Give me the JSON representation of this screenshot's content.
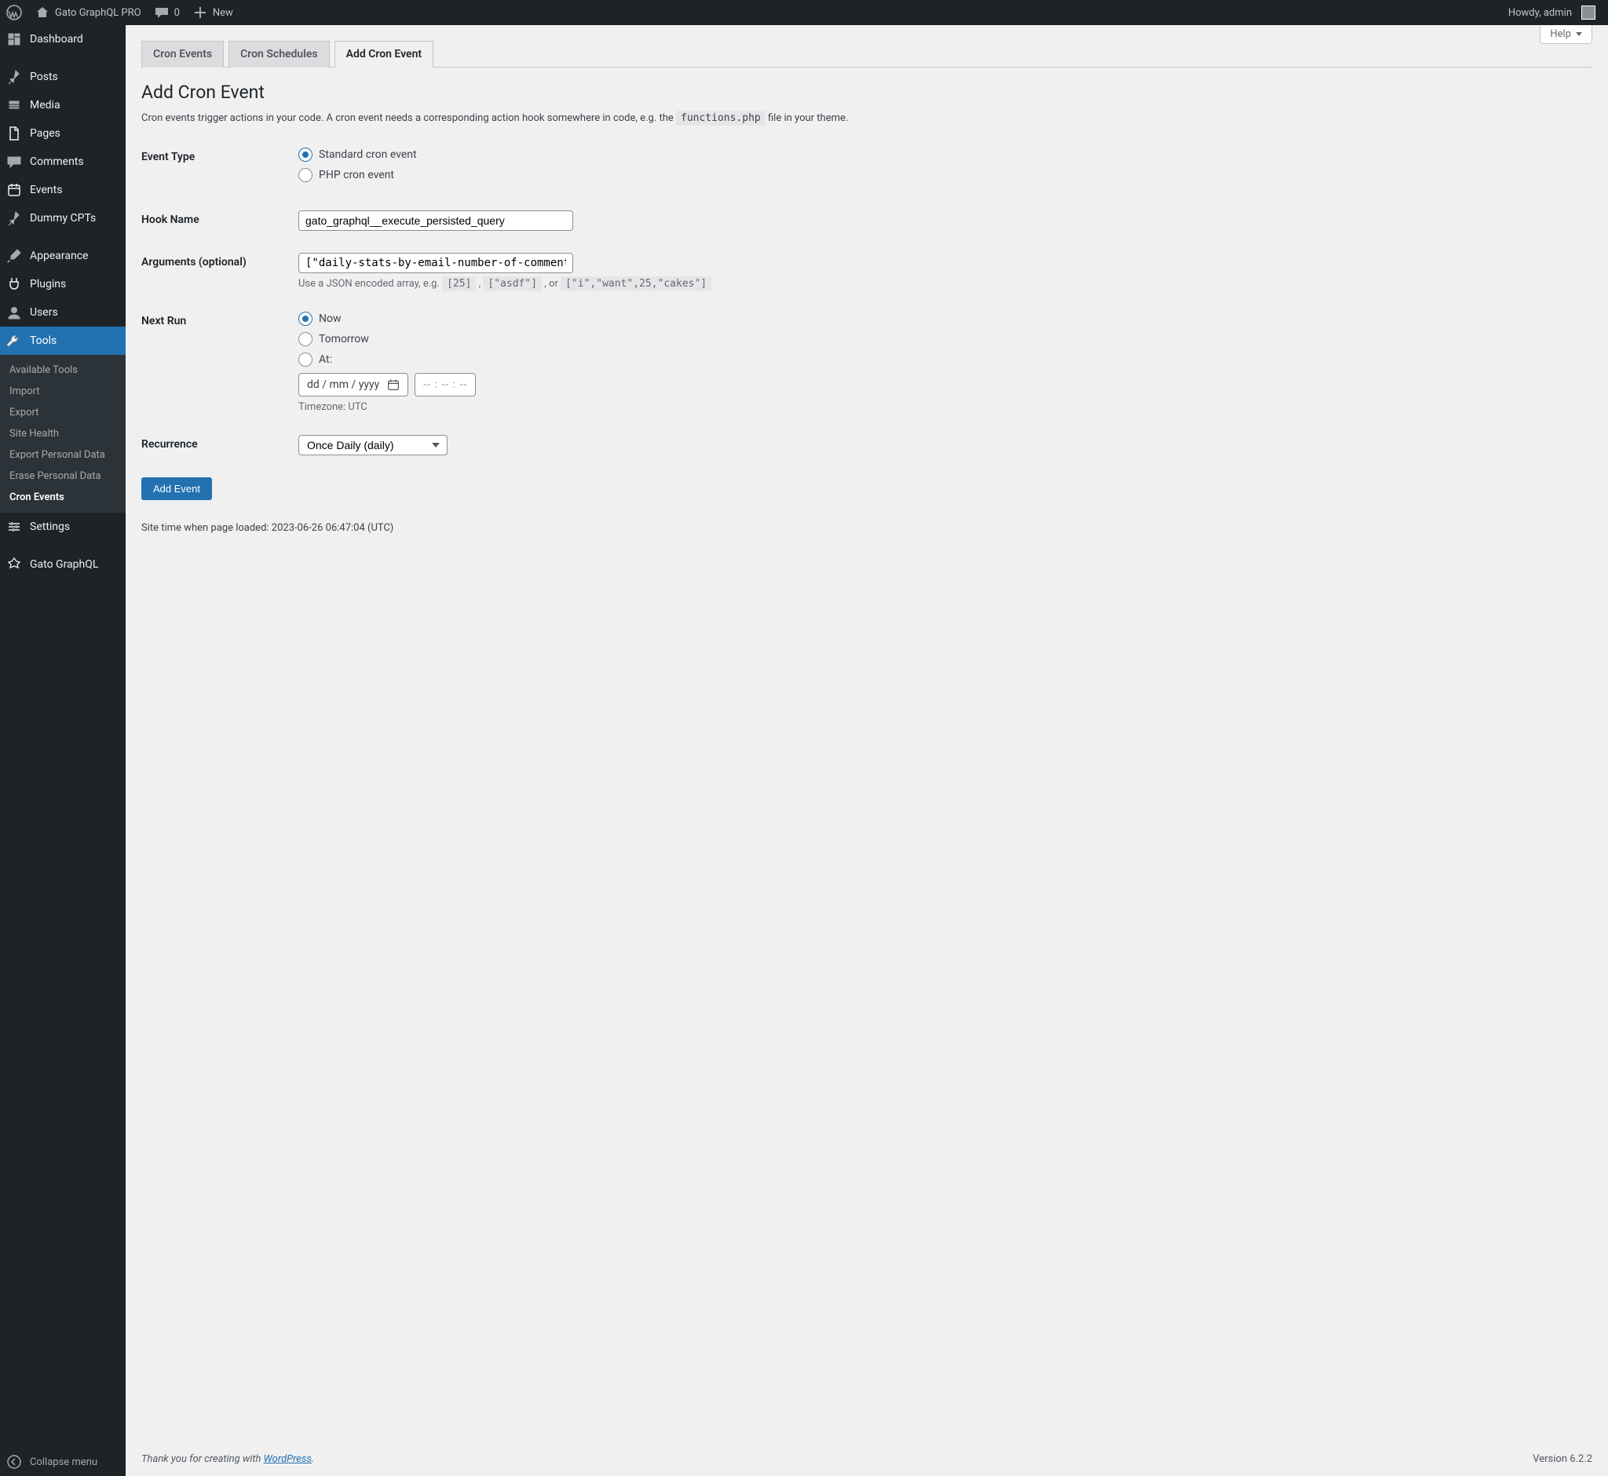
{
  "adminbar": {
    "site_title": "Gato GraphQL PRO",
    "comments_count": "0",
    "new_label": "New",
    "howdy": "Howdy, admin"
  },
  "sidebar": {
    "items": [
      {
        "label": "Dashboard",
        "icon": "dashboard"
      },
      {
        "label": "Posts",
        "icon": "pin"
      },
      {
        "label": "Media",
        "icon": "media"
      },
      {
        "label": "Pages",
        "icon": "page"
      },
      {
        "label": "Comments",
        "icon": "comment"
      },
      {
        "label": "Events",
        "icon": "calendar"
      },
      {
        "label": "Dummy CPTs",
        "icon": "pin"
      },
      {
        "label": "Appearance",
        "icon": "brush"
      },
      {
        "label": "Plugins",
        "icon": "plug"
      },
      {
        "label": "Users",
        "icon": "user"
      },
      {
        "label": "Tools",
        "icon": "wrench",
        "current": true
      },
      {
        "label": "Settings",
        "icon": "sliders"
      },
      {
        "label": "Gato GraphQL",
        "icon": "gato"
      }
    ],
    "submenu": [
      "Available Tools",
      "Import",
      "Export",
      "Site Health",
      "Export Personal Data",
      "Erase Personal Data",
      "Cron Events"
    ],
    "submenu_current": "Cron Events",
    "collapse_label": "Collapse menu"
  },
  "screen": {
    "help_label": "Help"
  },
  "tabs": [
    {
      "label": "Cron Events",
      "active": false
    },
    {
      "label": "Cron Schedules",
      "active": false
    },
    {
      "label": "Add Cron Event",
      "active": true
    }
  ],
  "page": {
    "title": "Add Cron Event",
    "intro_prefix": "Cron events trigger actions in your code. A cron event needs a corresponding action hook somewhere in code, e.g. the ",
    "intro_code": "functions.php",
    "intro_suffix": " file in your theme."
  },
  "form": {
    "event_type": {
      "label": "Event Type",
      "options": {
        "standard": "Standard cron event",
        "php": "PHP cron event"
      },
      "selected": "standard"
    },
    "hook": {
      "label": "Hook Name",
      "value": "gato_graphql__execute_persisted_query"
    },
    "arguments": {
      "label": "Arguments (optional)",
      "value": "[\"daily-stats-by-email-number-of-comment",
      "help_prefix": "Use a JSON encoded array, e.g. ",
      "example1": "[25]",
      "sep1": " , ",
      "example2": "[\"asdf\"]",
      "sep2": " , or ",
      "example3": "[\"i\",\"want\",25,\"cakes\"]"
    },
    "next_run": {
      "label": "Next Run",
      "options": {
        "now": "Now",
        "tomorrow": "Tomorrow",
        "at": "At:"
      },
      "selected": "now",
      "date_placeholder": "dd / mm / yyyy",
      "time_placeholder": "-- : -- : --",
      "timezone_label": "Timezone: UTC"
    },
    "recurrence": {
      "label": "Recurrence",
      "selected": "Once Daily (daily)"
    },
    "submit_label": "Add Event"
  },
  "footer": {
    "site_time": "Site time when page loaded: 2023-06-26 06:47:04 (UTC)",
    "thanks_prefix": "Thank you for creating with ",
    "thanks_link": "WordPress",
    "thanks_suffix": ".",
    "version": "Version 6.2.2"
  }
}
